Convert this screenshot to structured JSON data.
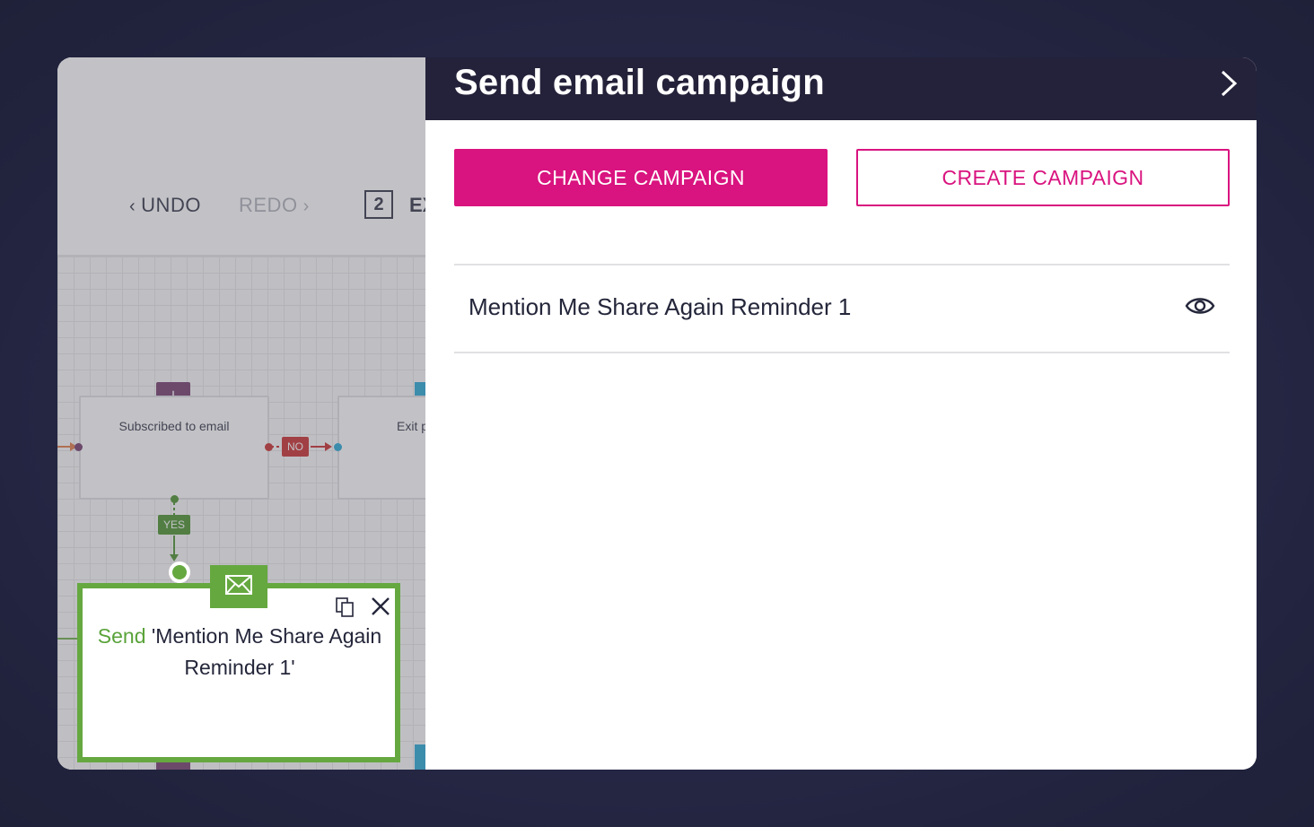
{
  "toolbar": {
    "undo_label": "UNDO",
    "redo_label": "REDO",
    "count": "2",
    "exit_label_partial": "EX"
  },
  "canvas": {
    "subscribed_node_title": "Subscribed to email",
    "exit_node_title_partial": "Exit p",
    "no_badge": "NO",
    "yes_badge": "YES",
    "send_node": {
      "verb": "Send",
      "campaign_quoted": "'Mention Me Share Again Reminder 1'"
    }
  },
  "panel": {
    "title": "Send email campaign",
    "change_button": "CHANGE CAMPAIGN",
    "create_button": "CREATE CAMPAIGN",
    "campaign_name": "Mention Me Share Again Reminder 1"
  },
  "colors": {
    "accent_pink": "#d9137f",
    "header_dark": "#24213a",
    "send_green": "#65a83f",
    "no_red": "#c62020",
    "yes_green": "#3e8b1e"
  }
}
